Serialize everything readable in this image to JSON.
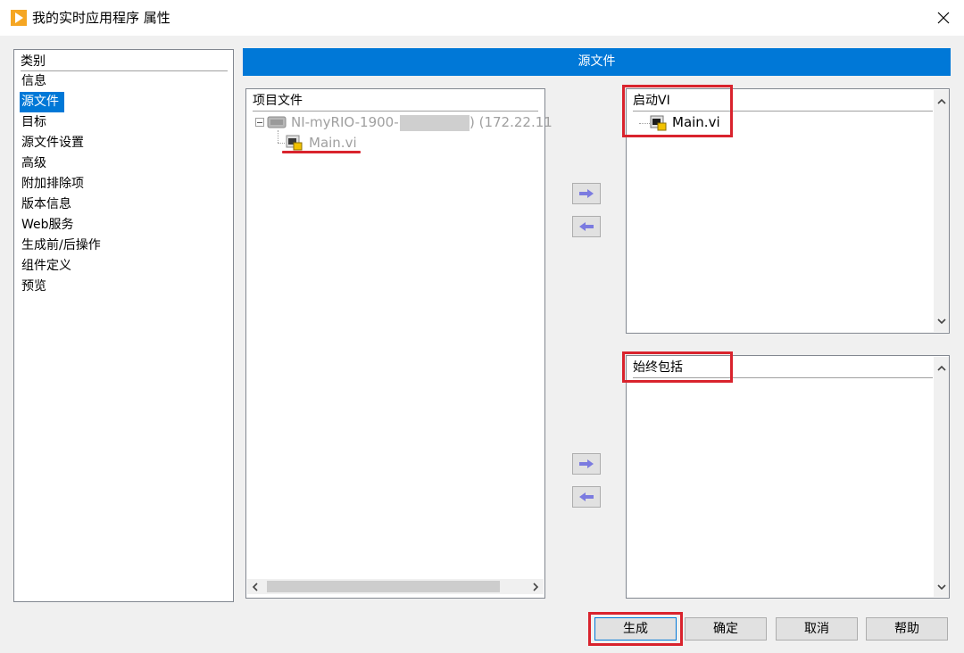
{
  "window": {
    "title": "我的实时应用程序 属性",
    "close_glyph": "×"
  },
  "category": {
    "header": "类别",
    "items": [
      "信息",
      "源文件",
      "目标",
      "源文件设置",
      "高级",
      "附加排除项",
      "版本信息",
      "Web服务",
      "生成前/后操作",
      "组件定义",
      "预览"
    ],
    "selected_index": 1
  },
  "section": {
    "title": "源文件"
  },
  "project_files": {
    "header": "项目文件",
    "target_name": "NI-myRIO-1900-",
    "target_ip": ") (172.22.11",
    "child_name": "Main.vi"
  },
  "startup_vi": {
    "header": "启动VI",
    "items": [
      "Main.vi"
    ]
  },
  "always_include": {
    "header": "始终包括",
    "items": []
  },
  "buttons": {
    "build": "生成",
    "ok": "确定",
    "cancel": "取消",
    "help": "帮助"
  },
  "colors": {
    "accent": "#0078d7",
    "annotation": "#d9232d",
    "arrow": "#7b7be0"
  }
}
